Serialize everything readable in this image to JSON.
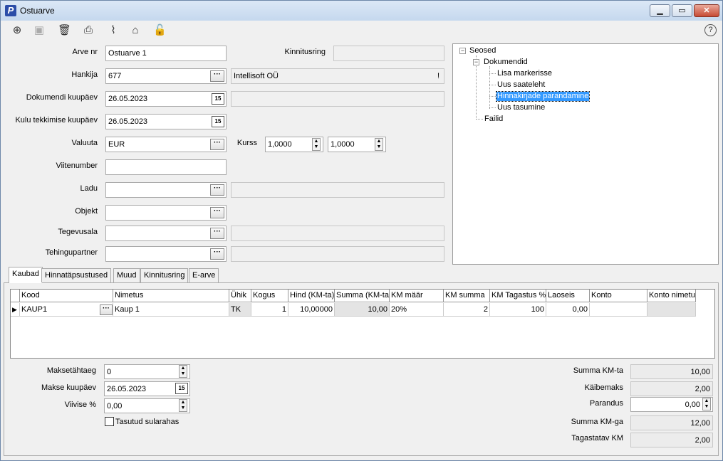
{
  "window": {
    "app_icon_letter": "P",
    "title": "Ostuarve",
    "min_label": "▁",
    "max_label": "▭",
    "close_label": "✕"
  },
  "toolbar": {
    "new_icon": "⊕",
    "save_icon": "▣",
    "delete_icon": "🗑",
    "print_icon": "⎙",
    "attach_icon": "⌇",
    "tag_icon": "⌂",
    "lock_icon": "🔓",
    "help_label": "?"
  },
  "form": {
    "arve_nr_label": "Arve nr",
    "arve_nr_value": "Ostuarve 1",
    "kinnitusring_label": "Kinnitusring",
    "kinnitusring_value": "",
    "hankija_label": "Hankija",
    "hankija_value": "677",
    "hankija_name": "Intellisoft OÜ",
    "hankija_flag": "!",
    "dok_kuupaev_label": "Dokumendi kuupäev",
    "dok_kuupaev_value": "26.05.2023",
    "kulu_kuupaev_label": "Kulu tekkimise kuupäev",
    "kulu_kuupaev_value": "26.05.2023",
    "valuuta_label": "Valuuta",
    "valuuta_value": "EUR",
    "kurss_label": "Kurss",
    "kurss_value1": "1,0000",
    "kurss_value2": "1,0000",
    "viitenumber_label": "Viitenumber",
    "viitenumber_value": "",
    "ladu_label": "Ladu",
    "ladu_value": "",
    "objekt_label": "Objekt",
    "objekt_value": "",
    "tegevusala_label": "Tegevusala",
    "tegevusala_value": "",
    "tehingupartner_label": "Tehingupartner",
    "tehingupartner_value": "",
    "calendar_glyph": "15",
    "ellipsis_glyph": "···"
  },
  "tree": {
    "root": "Seosed",
    "dokumendid": "Dokumendid",
    "items": [
      "Lisa markerisse",
      "Uus saateleht",
      "Hinnakirjade parandamine",
      "Uus tasumine"
    ],
    "failid": "Failid",
    "expanded_glyph": "−"
  },
  "tabs": [
    "Kaubad",
    "Hinnatäpsustused",
    "Muud",
    "Kinnitusring",
    "E-arve"
  ],
  "grid": {
    "columns": [
      "Kood",
      "Nimetus",
      "Ühik",
      "Kogus",
      "Hind (KM-ta)",
      "Summa (KM-ta)",
      "KM määr",
      "KM summa",
      "KM Tagastus %",
      "Laoseis",
      "Konto",
      "Konto nimetus"
    ],
    "row": {
      "kood": "KAUP1",
      "nimetus": "Kaup 1",
      "uhik": "TK",
      "kogus": "1",
      "hind": "10,00000",
      "summa": "10,00",
      "km_maar": "20%",
      "km_summa": "2",
      "km_tagastus": "100",
      "laoseis": "0,00",
      "konto": "",
      "konto_nimetus": ""
    },
    "row_indicator": "▶"
  },
  "payment": {
    "maksetahtaeg_label": "Maksetähtaeg",
    "maksetahtaeg_value": "0",
    "makse_kuupaev_label": "Makse kuupäev",
    "makse_kuupaev_value": "26.05.2023",
    "viivise_label": "Viivise %",
    "viivise_value": "0,00",
    "tasutud_label": "Tasutud sularahas"
  },
  "totals": {
    "summa_kmta_label": "Summa KM-ta",
    "summa_kmta_value": "10,00",
    "kaibemaks_label": "Käibemaks",
    "kaibemaks_value": "2,00",
    "parandus_label": "Parandus",
    "parandus_value": "0,00",
    "summa_kmga_label": "Summa KM-ga",
    "summa_kmga_value": "12,00",
    "tagastatav_label": "Tagastatav KM",
    "tagastatav_value": "2,00"
  }
}
